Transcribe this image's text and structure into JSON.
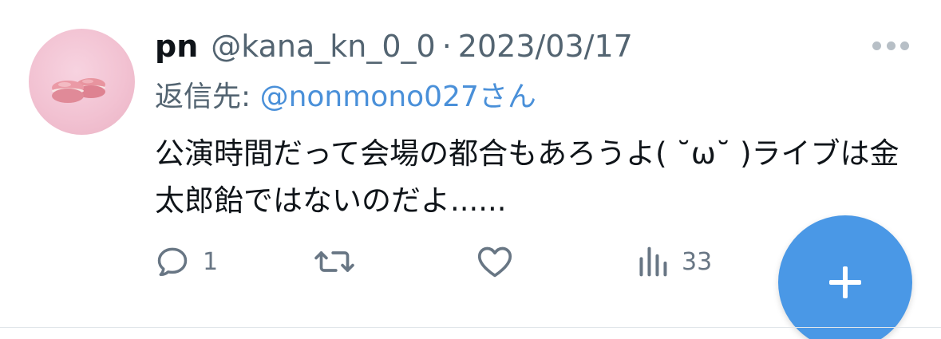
{
  "tweet": {
    "author_name": "pn",
    "handle": "@kana_kn_0_0",
    "separator": "·",
    "date": "2023/03/17",
    "reply_prefix": "返信先: ",
    "reply_mention": "@nonmono027",
    "reply_suffix": "さん",
    "text": "公演時間だって会場の都合もあろうよ( ˘ω˘ )ライブは金太郎飴ではないのだよ......",
    "avatar_icon": "macaron-avatar"
  },
  "actions": {
    "reply_count": "1",
    "retweet_count": "",
    "like_count": "",
    "views_count": "33"
  },
  "fab": {
    "icon": "plus-icon",
    "color": "#4a98e6"
  },
  "colors": {
    "text": "#0f1419",
    "secondary": "#536471",
    "link": "#4a90d9",
    "icon": "#687684"
  }
}
